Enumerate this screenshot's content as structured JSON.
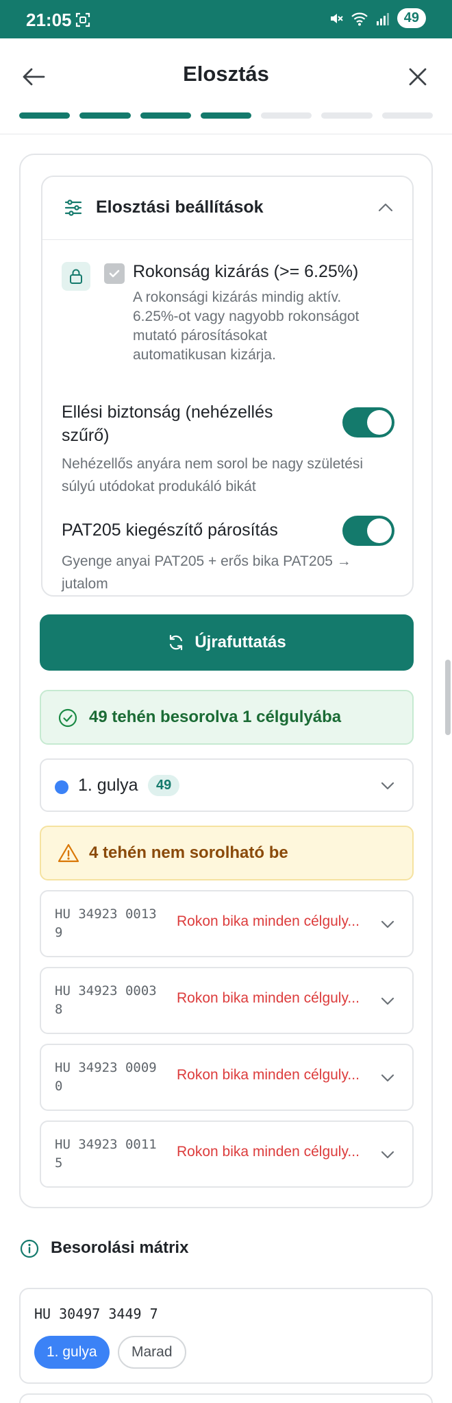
{
  "status_bar": {
    "time": "21:05",
    "battery": "49"
  },
  "header": {
    "title": "Elosztás",
    "progress": {
      "completed": 4,
      "total": 7
    }
  },
  "settings": {
    "title": "Elosztási beállítások",
    "kinship": {
      "title": "Rokonság kizárás (>= 6.25%)",
      "desc_lines": [
        "A rokonsági kizárás mindig aktív.",
        "6.25%-ot vagy nagyobb rokonságot",
        "mutató párosításokat",
        "automatikusan kizárja."
      ]
    },
    "calving": {
      "title_lines": [
        "Ellési biztonság (nehézellés",
        "szűrő)"
      ],
      "desc_lines": [
        "Nehézellős anyára nem sorol be nagy születési",
        "súlyú utódokat produkáló bikát"
      ],
      "enabled": true
    },
    "pat205": {
      "title": "PAT205 kiegészítő párosítás",
      "desc_lines": [
        "Gyenge anyai PAT205 + erős bika PAT205 →",
        "jutalom"
      ],
      "enabled": true
    }
  },
  "rerun_button": {
    "label": "Újrafuttatás"
  },
  "success_banner": {
    "text": "49 tehén besorolva 1 célgulyába"
  },
  "herd": {
    "name": "1. gulya",
    "count": "49",
    "color": "#3b82f6"
  },
  "warning_banner": {
    "text": "4 tehén nem sorolható be"
  },
  "excluded": [
    {
      "id": "HU 34923 0013 9",
      "reason": "Rokon bika minden célguly..."
    },
    {
      "id": "HU 34923 0003 8",
      "reason": "Rokon bika minden célguly..."
    },
    {
      "id": "HU 34923 0009 0",
      "reason": "Rokon bika minden célguly..."
    },
    {
      "id": "HU 34923 0011 5",
      "reason": "Rokon bika minden célguly..."
    }
  ],
  "matrix": {
    "title": "Besorolási mátrix",
    "rows": [
      {
        "cow_id": "HU 30497 3449 7",
        "options": [
          "1. gulya",
          "Marad"
        ],
        "selected": "1. gulya"
      }
    ]
  },
  "colors": {
    "accent": "#147a6c",
    "success": "#1b6b35",
    "warning": "#8a4a0a",
    "error": "#dc3c3c",
    "herd_blue": "#3b82f6"
  }
}
